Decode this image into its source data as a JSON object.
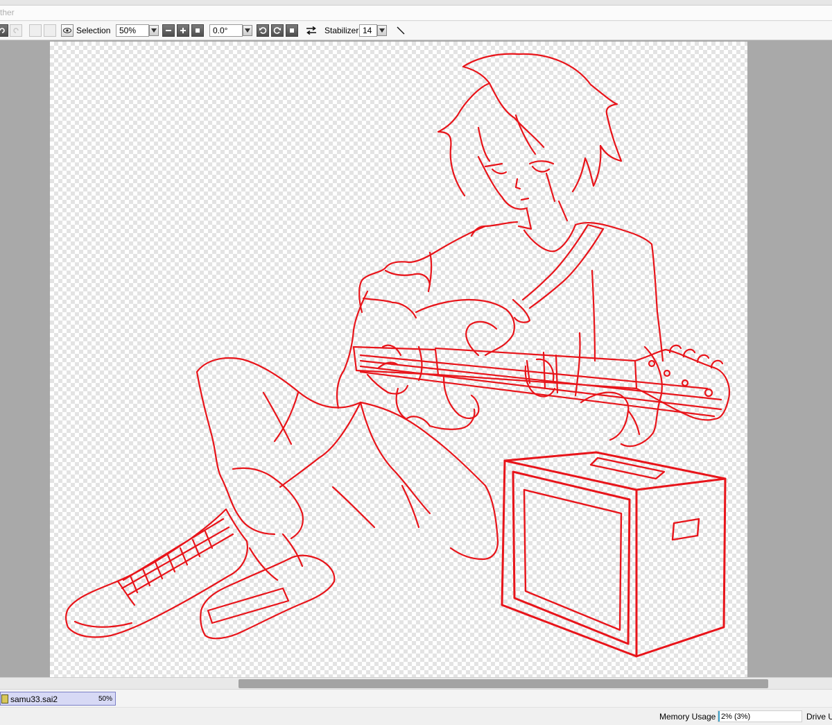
{
  "menu": {
    "partial_item": "ther"
  },
  "toolbar": {
    "view_label": "Selection",
    "zoom_value": "50%",
    "rotation_value": "0.0°",
    "stabilizer_label": "Stabilizer",
    "stabilizer_value": "14"
  },
  "document": {
    "filename": "samu33.sai2",
    "zoom": "50%"
  },
  "status": {
    "memory_label": "Memory Usage",
    "memory_value": "2% (3%)",
    "memory_fraction": 0.02,
    "drive_label": "Drive U"
  },
  "colors": {
    "linework": "#e8141a",
    "canvas_bg": "#a9a9a9",
    "tab_bg": "#d7d9f5",
    "memory_bar": "#3aa0c8"
  },
  "icons": [
    "undo-icon",
    "redo-icon",
    "eye-icon",
    "zoom-out-icon",
    "zoom-in-icon",
    "zoom-reset-icon",
    "rotate-ccw-icon",
    "rotate-cw-icon",
    "rotate-reset-icon",
    "flip-icon",
    "line-tool-icon",
    "file-icon"
  ]
}
